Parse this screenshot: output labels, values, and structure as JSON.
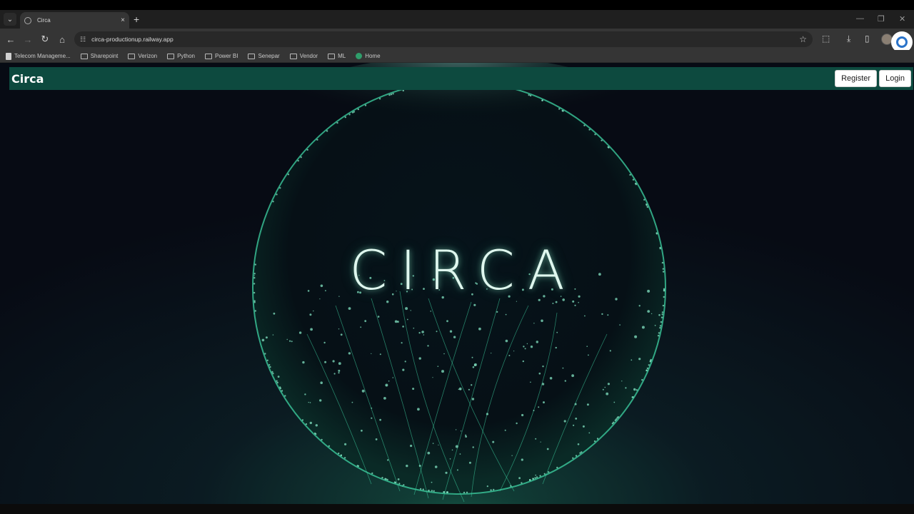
{
  "browser": {
    "tab_title": "Circa",
    "url": "circa-productionup.railway.app",
    "tab_search_icon": "chevron-down-icon",
    "new_tab_glyph": "+",
    "close_glyph": "×",
    "bookmarks": [
      {
        "label": "Telecom Manageme...",
        "icon": "page-icon"
      },
      {
        "label": "Sharepoint",
        "icon": "folder-icon"
      },
      {
        "label": "Verizon",
        "icon": "folder-icon"
      },
      {
        "label": "Python",
        "icon": "folder-icon"
      },
      {
        "label": "Power BI",
        "icon": "folder-icon"
      },
      {
        "label": "Senepar",
        "icon": "folder-icon"
      },
      {
        "label": "Vendor",
        "icon": "folder-icon"
      },
      {
        "label": "ML",
        "icon": "folder-icon"
      },
      {
        "label": "Home",
        "icon": "home-icon"
      }
    ]
  },
  "site": {
    "brand": "Circa",
    "register_label": "Register",
    "login_label": "Login",
    "hero_word": "CIRCA"
  },
  "colors": {
    "navbar_bg": "#0d4a3f",
    "glow": "#3fd6a6",
    "page_bg": "#0a0f18"
  }
}
